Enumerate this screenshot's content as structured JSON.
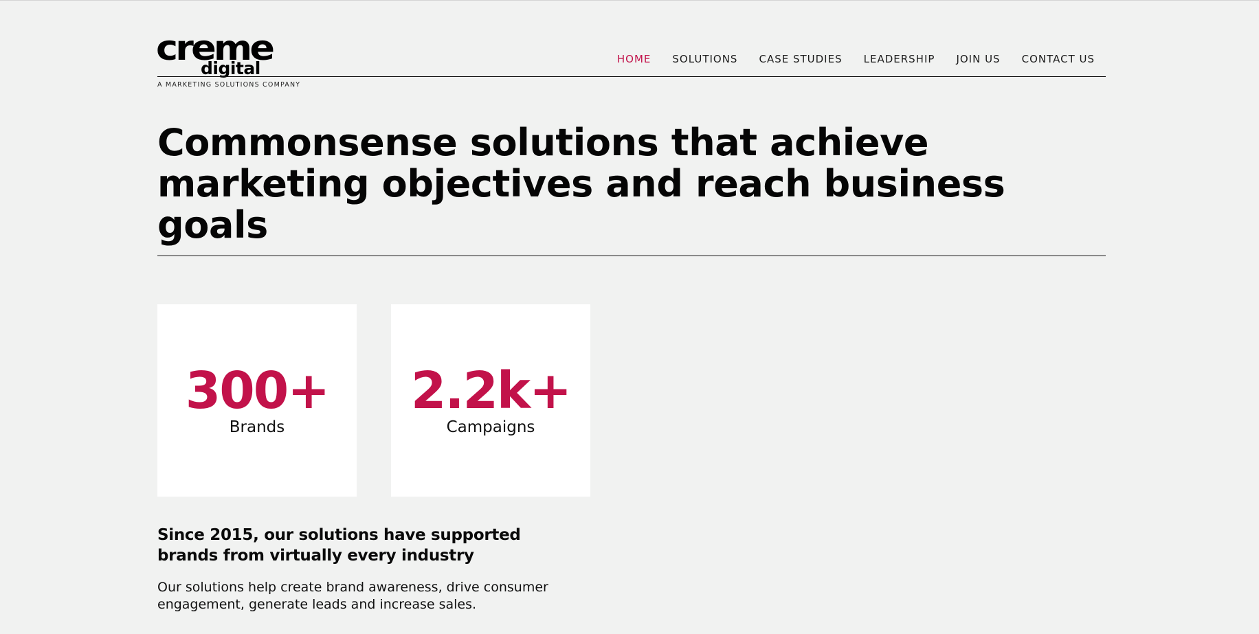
{
  "logo": {
    "brand": "creme",
    "sub": "digital",
    "tagline": "A MARKETING SOLUTIONS COMPANY"
  },
  "nav": {
    "items": [
      {
        "label": "HOME",
        "active": true
      },
      {
        "label": "SOLUTIONS",
        "active": false
      },
      {
        "label": "CASE STUDIES",
        "active": false
      },
      {
        "label": "LEADERSHIP",
        "active": false
      },
      {
        "label": "JOIN US",
        "active": false
      },
      {
        "label": "CONTACT US",
        "active": false
      }
    ]
  },
  "hero": {
    "title": "Commonsense solutions that achieve marketing objectives and reach business goals"
  },
  "stats": [
    {
      "value": "300+",
      "label": "Brands"
    },
    {
      "value": "2.2k+",
      "label": "Campaigns"
    }
  ],
  "about": {
    "heading": "Since 2015, our solutions have supported brands from virtually every industry",
    "text": "Our solutions help create brand awareness, drive consumer engagement, generate leads and increase sales."
  },
  "colors": {
    "accent": "#c2124a",
    "background": "#f1f2f1",
    "card": "#ffffff",
    "text": "#0b0b0b"
  }
}
